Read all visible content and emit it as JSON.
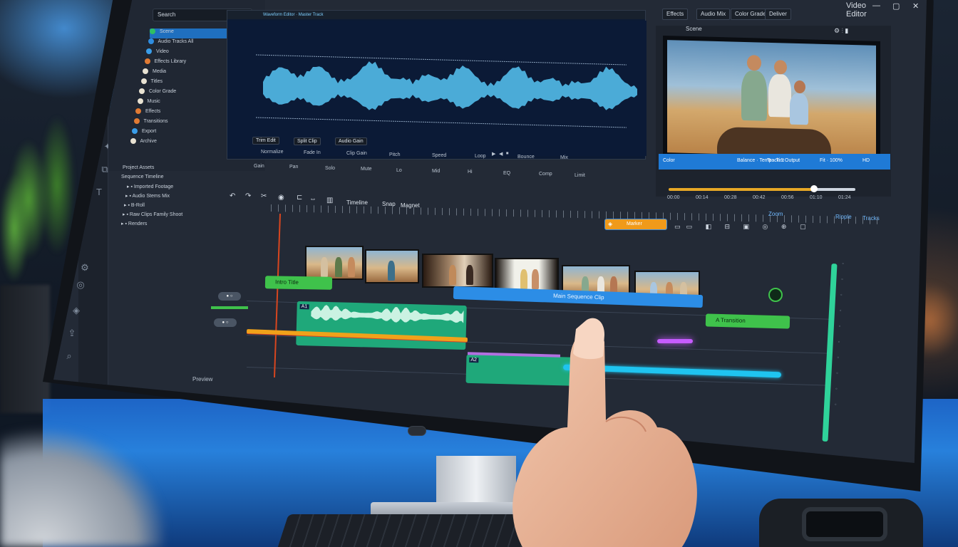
{
  "media_panel": {
    "search_value": "Search",
    "items": [
      {
        "label": "Scene",
        "color": "#2fbf63",
        "selected": true
      },
      {
        "label": "Audio Tracks All",
        "color": "#2f8de0"
      },
      {
        "label": "Video",
        "color": "#3a9de8"
      },
      {
        "label": "Effects Library",
        "color": "#e07a33"
      },
      {
        "label": "Media",
        "color": "#e8e2d2"
      },
      {
        "label": "Titles",
        "color": "#e8e2d2"
      },
      {
        "label": "Color Grade",
        "color": "#e8e2d2"
      },
      {
        "label": "Music",
        "color": "#e8e2d2"
      },
      {
        "label": "Effects",
        "color": "#e07a33"
      },
      {
        "label": "Transitions",
        "color": "#e07a33"
      },
      {
        "label": "Export",
        "color": "#3a9de8"
      },
      {
        "label": "Archive",
        "color": "#e8e2d2"
      }
    ],
    "project_tree": [
      "Project Assets",
      "Sequence Timeline",
      "Imported Footage",
      "Audio Stems Mix",
      "B-Roll",
      "Raw Clips Family Shoot",
      "Renders"
    ]
  },
  "waveform": {
    "header": "Waveform Editor · Master Track",
    "controls_row1": [
      "Normalize",
      "Fade In",
      "Clip Gain",
      "Pitch",
      "Speed",
      "Loop",
      "Bounce",
      "Mix"
    ],
    "controls_row2": [
      "Gain",
      "Pan",
      "Solo",
      "Mute",
      "Lo",
      "Mid",
      "Hi",
      "EQ",
      "Comp",
      "Limit"
    ],
    "toolbar_buttons": [
      "Trim Edit",
      "Split Clip",
      "Audio Gain"
    ],
    "color": "#4fb3e0"
  },
  "top_right": {
    "title": "Video Editor",
    "tabs": [
      "Effects",
      "Audio Mix",
      "Color Grade",
      "Deliver"
    ],
    "window_controls": [
      "—",
      "▢",
      "✕"
    ]
  },
  "preview": {
    "title": "Scene",
    "bar_labels": [
      "Color",
      "Balance · Temp · Tint",
      "Track 1 Output",
      "Fit · 100%",
      "HD"
    ],
    "timecodes": [
      "00:00",
      "00:14",
      "00:28",
      "00:42",
      "00:56",
      "01:10",
      "01:24"
    ],
    "playback_progress": 0.78
  },
  "timeline_toolbar": {
    "labels": [
      "Timeline",
      "Snap",
      "Magnet"
    ],
    "right_labels": [
      "Zoom",
      "Ripple",
      "Tracks"
    ],
    "marker_label": "Marker"
  },
  "tracks": {
    "video_clip_label_left": "Intro Title",
    "video_clip_label_mid": "Main Sequence Clip",
    "video_clip_label_right": "A Transition",
    "audio_clip_badge": "A1",
    "audio_clip_badge2": "A2"
  },
  "status_bar": "Preview",
  "colors": {
    "accent_blue": "#1f7ad6",
    "clip_green": "#3fc24b",
    "audio_teal": "#2bb58a",
    "orange_line": "#f0a21a",
    "cyan_line": "#1fc4f0",
    "purple_marker": "#c65cff"
  }
}
